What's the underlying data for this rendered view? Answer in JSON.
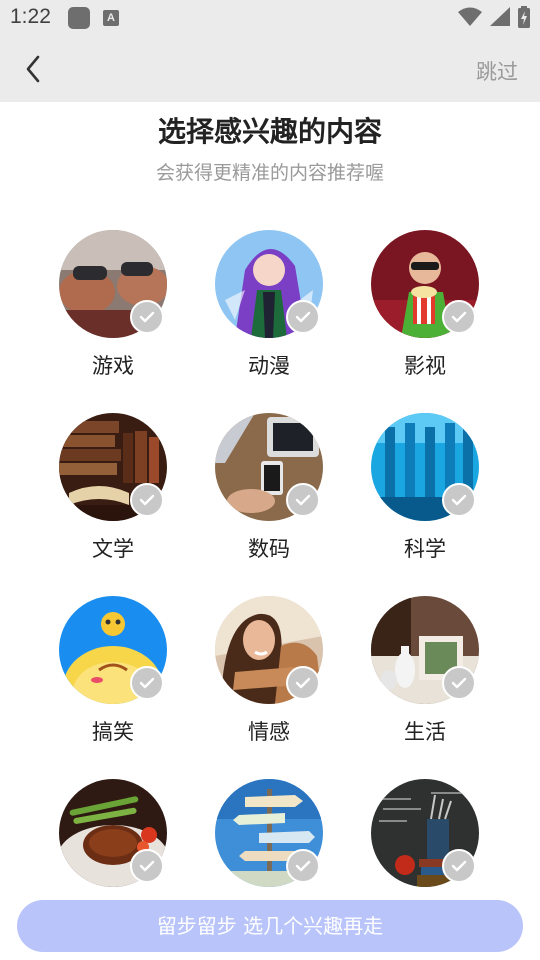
{
  "status_bar": {
    "time": "1:22",
    "a_icon": "A",
    "icons": [
      "app-icon",
      "a-icon",
      "wifi-icon",
      "signal-icon",
      "battery-charging-icon"
    ]
  },
  "nav": {
    "back_icon": "chevron-left-icon",
    "skip_label": "跳过"
  },
  "header": {
    "title": "选择感兴趣的内容",
    "subtitle": "会获得更精准的内容推荐喔"
  },
  "interests": [
    {
      "label": "游戏",
      "icon": "game-controller-photo",
      "selected": false
    },
    {
      "label": "动漫",
      "icon": "anime-character-photo",
      "selected": false
    },
    {
      "label": "影视",
      "icon": "cinema-popcorn-photo",
      "selected": false
    },
    {
      "label": "文学",
      "icon": "books-photo",
      "selected": false
    },
    {
      "label": "数码",
      "icon": "devices-photo",
      "selected": false
    },
    {
      "label": "科学",
      "icon": "lab-glassware-photo",
      "selected": false
    },
    {
      "label": "搞笑",
      "icon": "funny-emoji-photo",
      "selected": false
    },
    {
      "label": "情感",
      "icon": "hugging-couple-photo",
      "selected": false
    },
    {
      "label": "生活",
      "icon": "home-decor-photo",
      "selected": false
    },
    {
      "label": "",
      "icon": "steak-food-photo",
      "selected": false
    },
    {
      "label": "",
      "icon": "signpost-photo",
      "selected": false
    },
    {
      "label": "",
      "icon": "chalkboard-books-photo",
      "selected": false
    }
  ],
  "footer": {
    "button_label": "留步留步 选几个兴趣再走",
    "button_color": "#b9c4fb"
  }
}
